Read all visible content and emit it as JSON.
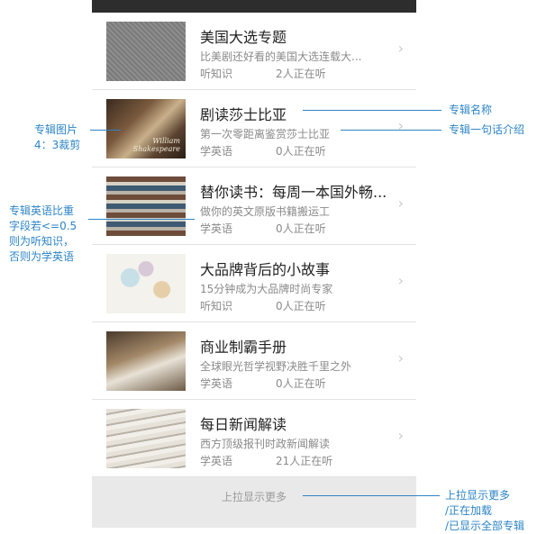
{
  "list": {
    "items": [
      {
        "title": "美国大选专题",
        "desc": "比美剧还好看的美国大选连载大...",
        "category": "听知识",
        "listening": "2人正在听",
        "thumb": "gray"
      },
      {
        "title": "剧读莎士比亚",
        "desc": "第一次零距离鉴赏莎士比亚",
        "category": "学英语",
        "listening": "0人正在听",
        "thumb": "shakes"
      },
      {
        "title": "替你读书：每周一本国外畅...",
        "desc": "做你的英文原版书籍搬运工",
        "category": "学英语",
        "listening": "0人正在听",
        "thumb": "books"
      },
      {
        "title": "大品牌背后的小故事",
        "desc": "15分钟成为大品牌时尚专家",
        "category": "听知识",
        "listening": "0人正在听",
        "thumb": "sketch"
      },
      {
        "title": "商业制霸手册",
        "desc": "全球眼光哲学视野决胜千里之外",
        "category": "学英语",
        "listening": "0人正在听",
        "thumb": "desk"
      },
      {
        "title": "每日新闻解读",
        "desc": "西方顶级报刊时政新闻解读",
        "category": "学英语",
        "listening": "21人正在听",
        "thumb": "news"
      }
    ],
    "chevron": "›",
    "thumb_signature": "William Shakespeare"
  },
  "footer": {
    "load_more": "上拉显示更多"
  },
  "annotations": {
    "album_name": "专辑名称",
    "album_intro": "专辑一句话介绍",
    "album_image_line1": "专辑图片",
    "album_image_line2": "4：3裁剪",
    "english_ratio_line1": "专辑英语比重",
    "english_ratio_line2": "字段若<=0.5",
    "english_ratio_line3": "则为听知识，",
    "english_ratio_line4": "否则为学英语",
    "load_line1": "上拉显示更多",
    "load_line2": "/正在加载",
    "load_line3": "/已显示全部专辑"
  },
  "colors": {
    "annotation": "#2d84c6",
    "topbar": "#2d2d2d",
    "footer_bg": "#e9e9e9"
  }
}
